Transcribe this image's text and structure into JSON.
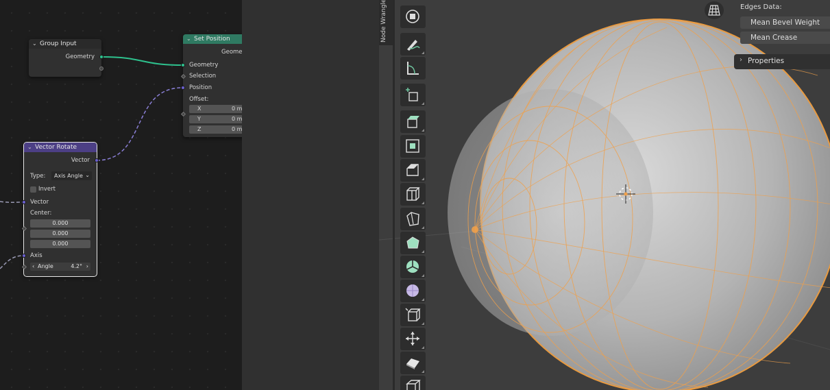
{
  "node_editor": {
    "group_input": {
      "title": "Group Input",
      "geometry_output": "Geometry"
    },
    "set_position": {
      "title": "Set Position",
      "geometry_output": "Geometry",
      "inputs": {
        "geometry": "Geometry",
        "selection": "Selection",
        "position": "Position",
        "offset": "Offset:"
      },
      "offset": [
        {
          "axis": "X",
          "value": "0 m"
        },
        {
          "axis": "Y",
          "value": "0 m"
        },
        {
          "axis": "Z",
          "value": "0 m"
        }
      ]
    },
    "vector_rotate": {
      "title": "Vector Rotate",
      "vector_output": "Vector",
      "type_label": "Type:",
      "type_value": "Axis Angle",
      "invert_label": "Invert",
      "vector_input": "Vector",
      "center_label": "Center:",
      "center": [
        "0.000",
        "0.000",
        "0.000"
      ],
      "axis_label": "Axis",
      "angle_label": "Angle",
      "angle_value": "4.2°"
    }
  },
  "viewport": {
    "side_tab": "Node Wrangler",
    "tools": [
      "view-navigate-icon",
      "annotate-icon",
      "measure-icon",
      "add-cube-icon",
      "extrude-region-icon",
      "inset-faces-icon",
      "bevel-icon",
      "loop-cut-icon",
      "knife-icon",
      "poly-build-icon",
      "spin-icon",
      "smooth-icon",
      "edge-slide-icon",
      "shrink-fatten-icon",
      "shear-icon",
      "rip-region-icon"
    ],
    "n_panel": {
      "edges_title": "Edges Data:",
      "mean_bevel_weight": "Mean Bevel Weight",
      "mean_crease": "Mean Crease",
      "properties": "Properties"
    }
  },
  "colors": {
    "geometry_socket": "#2ec28e",
    "vector_socket": "#6a5fcf",
    "wireframe": "#f0a04a",
    "mesh": "#a9a9a9"
  }
}
